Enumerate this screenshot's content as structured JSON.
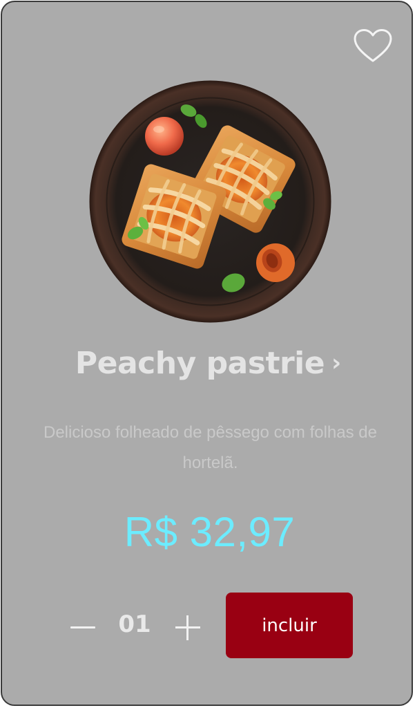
{
  "product": {
    "name": "Peachy pastrie",
    "chevron": "›",
    "description": "Delicioso folheado de pêssego com folhas de hortelã.",
    "price": "R$ 32,97"
  },
  "quantity": {
    "value": "01"
  },
  "actions": {
    "add_label": "incluir"
  },
  "icons": {
    "favorite": "heart-outline-icon",
    "decrease": "minus-icon",
    "increase": "plus-icon"
  },
  "colors": {
    "card_background": "#ababab",
    "price": "#6cecff",
    "add_button": "#990012",
    "title": "#e4e4e4"
  }
}
